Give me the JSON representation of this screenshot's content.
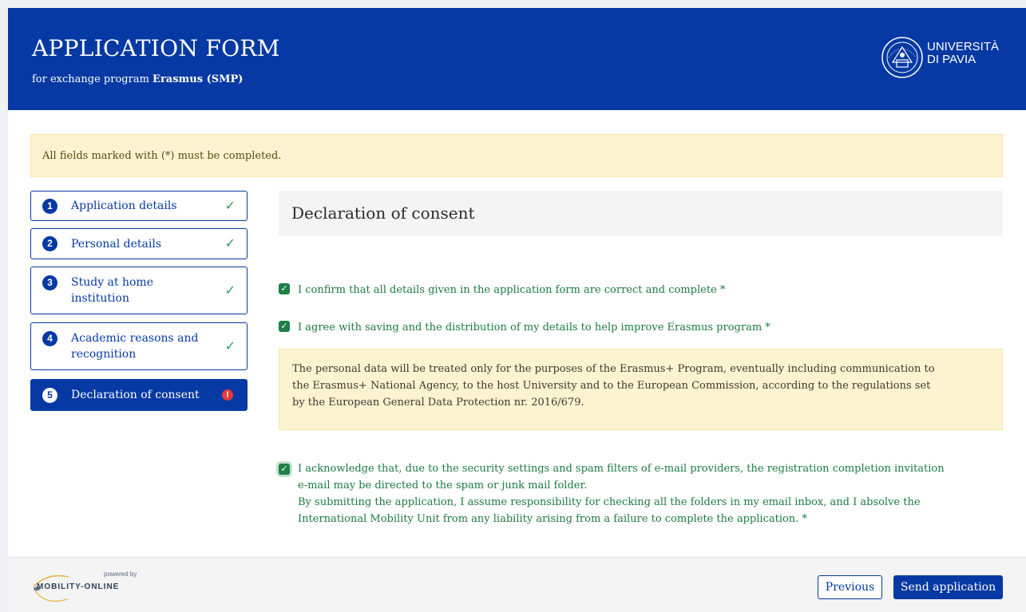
{
  "header": {
    "title": "APPLICATION FORM",
    "subtitle_prefix": "for exchange program ",
    "subtitle_program": "Erasmus (SMP)",
    "logo_line1": "UNIVERSITÀ",
    "logo_line2": "DI PAVIA",
    "logo_icon": "university-seal-icon"
  },
  "alert": {
    "text": "All fields marked with (*) must be completed."
  },
  "steps": [
    {
      "num": "1",
      "line1": "Application details",
      "line2": "",
      "status": "complete"
    },
    {
      "num": "2",
      "line1": "Personal details",
      "line2": "",
      "status": "complete"
    },
    {
      "num": "3",
      "line1": "Study at home",
      "line2": "institution",
      "status": "complete"
    },
    {
      "num": "4",
      "line1": "Academic reasons and",
      "line2": "recognition",
      "status": "complete"
    },
    {
      "num": "5",
      "line1": "Declaration of consent",
      "line2": "",
      "status": "error",
      "active": true
    }
  ],
  "icons": {
    "check": "✓",
    "warn": "!"
  },
  "main": {
    "title": "Declaration of consent",
    "confirm_text": "I confirm that all details given in the application form are correct and complete *",
    "agree_text": "I agree with saving and the distribution of my details to help improve Erasmus program *",
    "notice_lines": [
      "The personal data will be treated only for the purposes of the Erasmus+ Program, eventually including communication to",
      "the Erasmus+ National Agency, to the host University and to the European Commission, according to the regulations set",
      "by the European General Data Protection nr. 2016/679."
    ],
    "ack_lines": [
      "I acknowledge that, due to the security settings and spam filters of e-mail providers, the registration completion invitation",
      "e-mail may be directed to the spam or junk mail folder.",
      "By submitting the application, I assume responsibility for checking all the folders in my email inbox, and I absolve the",
      "International Mobility Unit from any liability arising from a failure to complete the application. *"
    ],
    "checkbox_states": {
      "confirm": true,
      "agree": true,
      "acknowledge": true
    }
  },
  "footer": {
    "powered_by": "powered by",
    "brand": "MOBILITY-ONLINE",
    "previous_label": "Previous",
    "send_label": "Send application"
  },
  "colors": {
    "brand": "#0639a3",
    "success": "#1e7f47",
    "warning_bg": "#fdf3d1",
    "error": "#e23a3a"
  }
}
